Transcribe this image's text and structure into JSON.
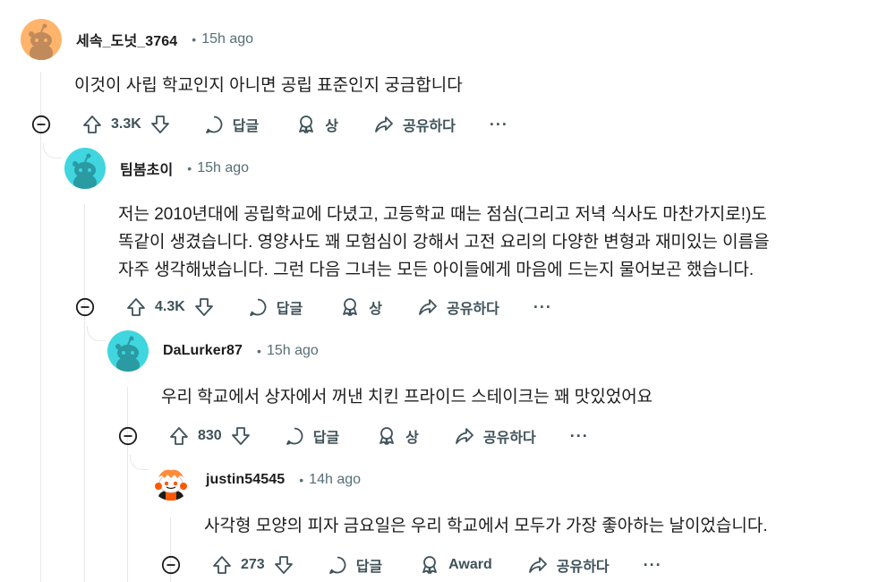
{
  "comments": [
    {
      "author": "세속_도넛_3764",
      "time": "15h ago",
      "body": "이것이 사립 학교인지 아니면 공립 표준인지 궁금합니다",
      "votes": "3.3K",
      "reply_label": "답글",
      "award_label": "상",
      "share_label": "공유하다",
      "more_label": "···",
      "avatar": "reddit-snoo-orange-icon"
    },
    {
      "author": "팀봄초이",
      "time": "15h ago",
      "body": "저는 2010년대에 공립학교에 다녔고, 고등학교 때는 점심(그리고 저녁 식사도 마찬가지로!)도\n똑같이 생겼습니다. 영양사도 꽤 모험심이 강해서 고전 요리의 다양한 변형과 재미있는 이름을\n자주 생각해냈습니다. 그런 다음 그녀는 모든 아이들에게 마음에 드는지 물어보곤 했습니다.",
      "votes": "4.3K",
      "reply_label": "답글",
      "award_label": "상",
      "share_label": "공유하다",
      "more_label": "···",
      "avatar": "reddit-snoo-teal-icon"
    },
    {
      "author": "DaLurker87",
      "time": "15h ago",
      "body": "우리 학교에서 상자에서 꺼낸 치킨 프라이드 스테이크는 꽤 맛있었어요",
      "votes": "830",
      "reply_label": "답글",
      "award_label": "상",
      "share_label": "공유하다",
      "more_label": "···",
      "avatar": "reddit-snoo-teal-icon"
    },
    {
      "author": "justin54545",
      "time": "14h ago",
      "body": "사각형 모양의 피자 금요일은 우리 학교에서 모두가 가장 좋아하는 날이었습니다.",
      "votes": "273",
      "reply_label": "답글",
      "award_label": "Award",
      "share_label": "공유하다",
      "more_label": "···",
      "avatar": "reddit-snoo-custom-icon"
    }
  ],
  "time_separator": "•",
  "colors": {
    "meta_gray": "#576f76",
    "thread_line": "#e5e7ea",
    "snoo_orange_bg": "#ffb46b",
    "snoo_teal_bg": "#3fd6e0"
  }
}
